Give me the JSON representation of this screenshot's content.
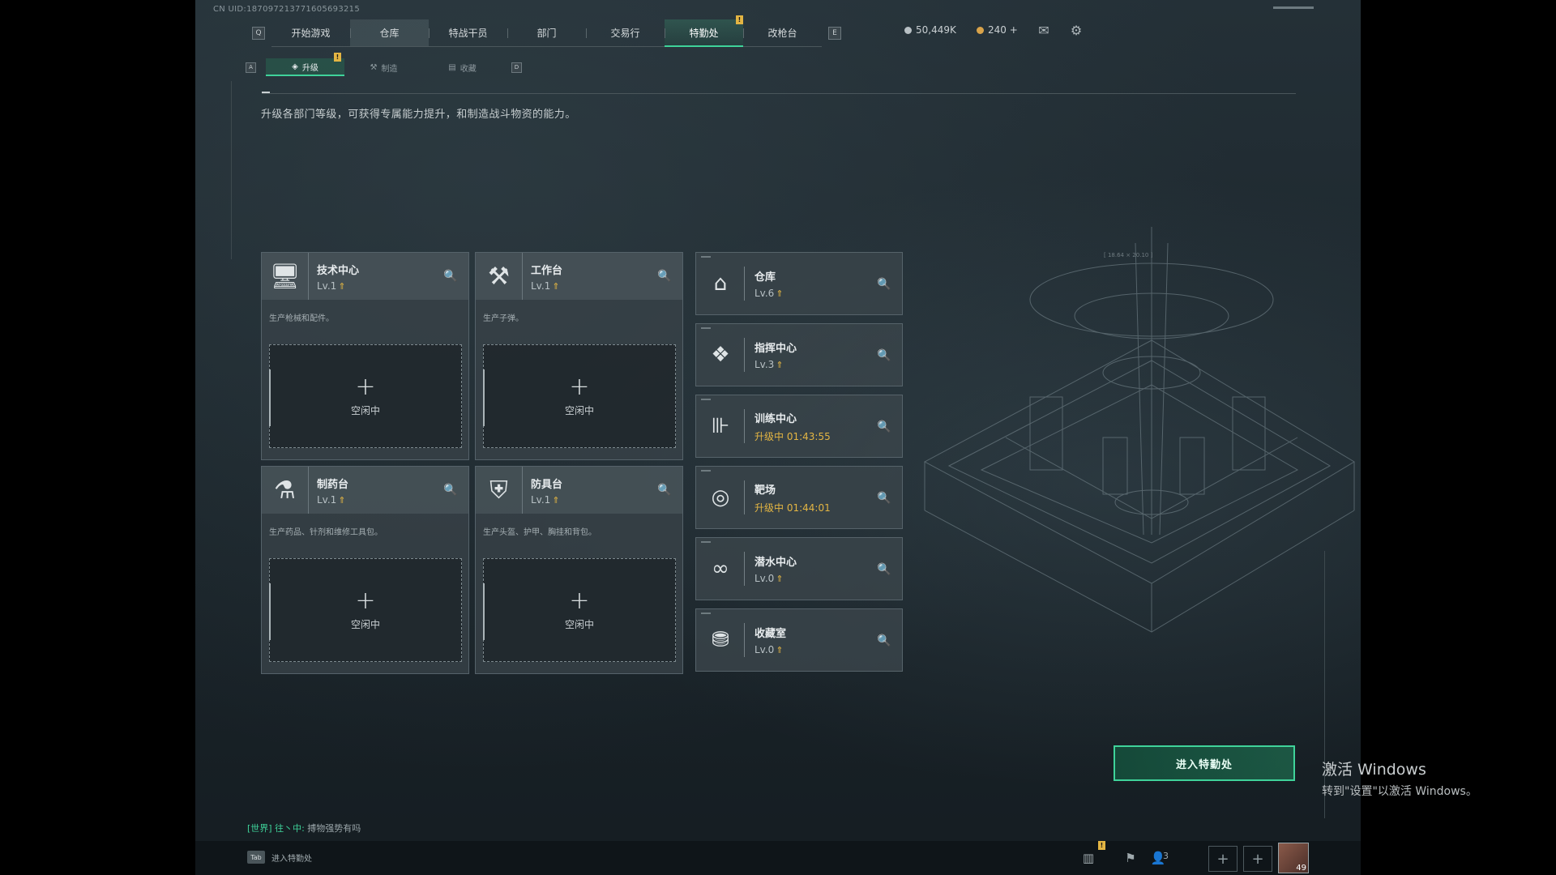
{
  "uid": "CN UID:18709721377160569321​5",
  "nav": {
    "key_left": "Q",
    "key_right": "E",
    "tabs": [
      {
        "label": "开始游戏"
      },
      {
        "label": "仓库"
      },
      {
        "label": "特战干员"
      },
      {
        "label": "部门"
      },
      {
        "label": "交易行"
      },
      {
        "label": "特勤处",
        "badge": "!"
      },
      {
        "label": "改枪台"
      }
    ],
    "active": "特勤处"
  },
  "currency": {
    "coins": "50,449K",
    "tokens": "240 +"
  },
  "subnav": {
    "key_left": "A",
    "key_right": "D",
    "tabs": [
      {
        "label": "升级",
        "badge": "!"
      },
      {
        "label": "制造"
      },
      {
        "label": "收藏"
      }
    ]
  },
  "description": "升级各部门等级，可获得专属能力提升，和制造战斗物资的能力。",
  "departments": [
    {
      "name": "技术中心",
      "level": "Lv.1",
      "desc": "生产枪械和配件。",
      "slot_plus": "+",
      "slot_status": "空闲中",
      "icon": "computer-icon"
    },
    {
      "name": "工作台",
      "level": "Lv.1",
      "desc": "生产子弹。",
      "slot_plus": "+",
      "slot_status": "空闲中",
      "icon": "tools-icon"
    },
    {
      "name": "制药台",
      "level": "Lv.1",
      "desc": "生产药品、针剂和维修工具包。",
      "slot_plus": "+",
      "slot_status": "空闲中",
      "icon": "pharmacy-icon"
    },
    {
      "name": "防具台",
      "level": "Lv.1",
      "desc": "生产头盔、护甲、胸挂和背包。",
      "slot_plus": "+",
      "slot_status": "空闲中",
      "icon": "armor-icon"
    }
  ],
  "facilities": [
    {
      "name": "仓库",
      "level": "Lv.6",
      "icon": "warehouse-icon"
    },
    {
      "name": "指挥中心",
      "level": "Lv.3",
      "icon": "command-icon"
    },
    {
      "name": "训练中心",
      "level": "升级中 01:43:55",
      "upgrading": true,
      "icon": "dumbbell-icon"
    },
    {
      "name": "靶场",
      "level": "升级中 01:44:01",
      "upgrading": true,
      "icon": "target-icon"
    },
    {
      "name": "潜水中心",
      "level": "Lv.0",
      "icon": "diving-mask-icon"
    },
    {
      "name": "收藏室",
      "level": "Lv.0",
      "icon": "collection-icon"
    }
  ],
  "enter_button": "进入特勤处",
  "chat": {
    "channel": "[世界] 往丶中:",
    "message": "搏物强势有吗"
  },
  "bottom": {
    "tab_key": "Tab",
    "tab_label": "进入特勤处",
    "stats_badge": "!",
    "players": "3",
    "add": "+",
    "avatar_level": "49"
  },
  "coord_text": "[ 18.64 × 20.10 ]",
  "watermark": {
    "title": "激活 Windows",
    "subtitle": "转到\"设置\"以激活 Windows。"
  },
  "colors": {
    "accent": "#3fd39a",
    "badge": "#e3b543",
    "upgrading": "#e3b543"
  }
}
